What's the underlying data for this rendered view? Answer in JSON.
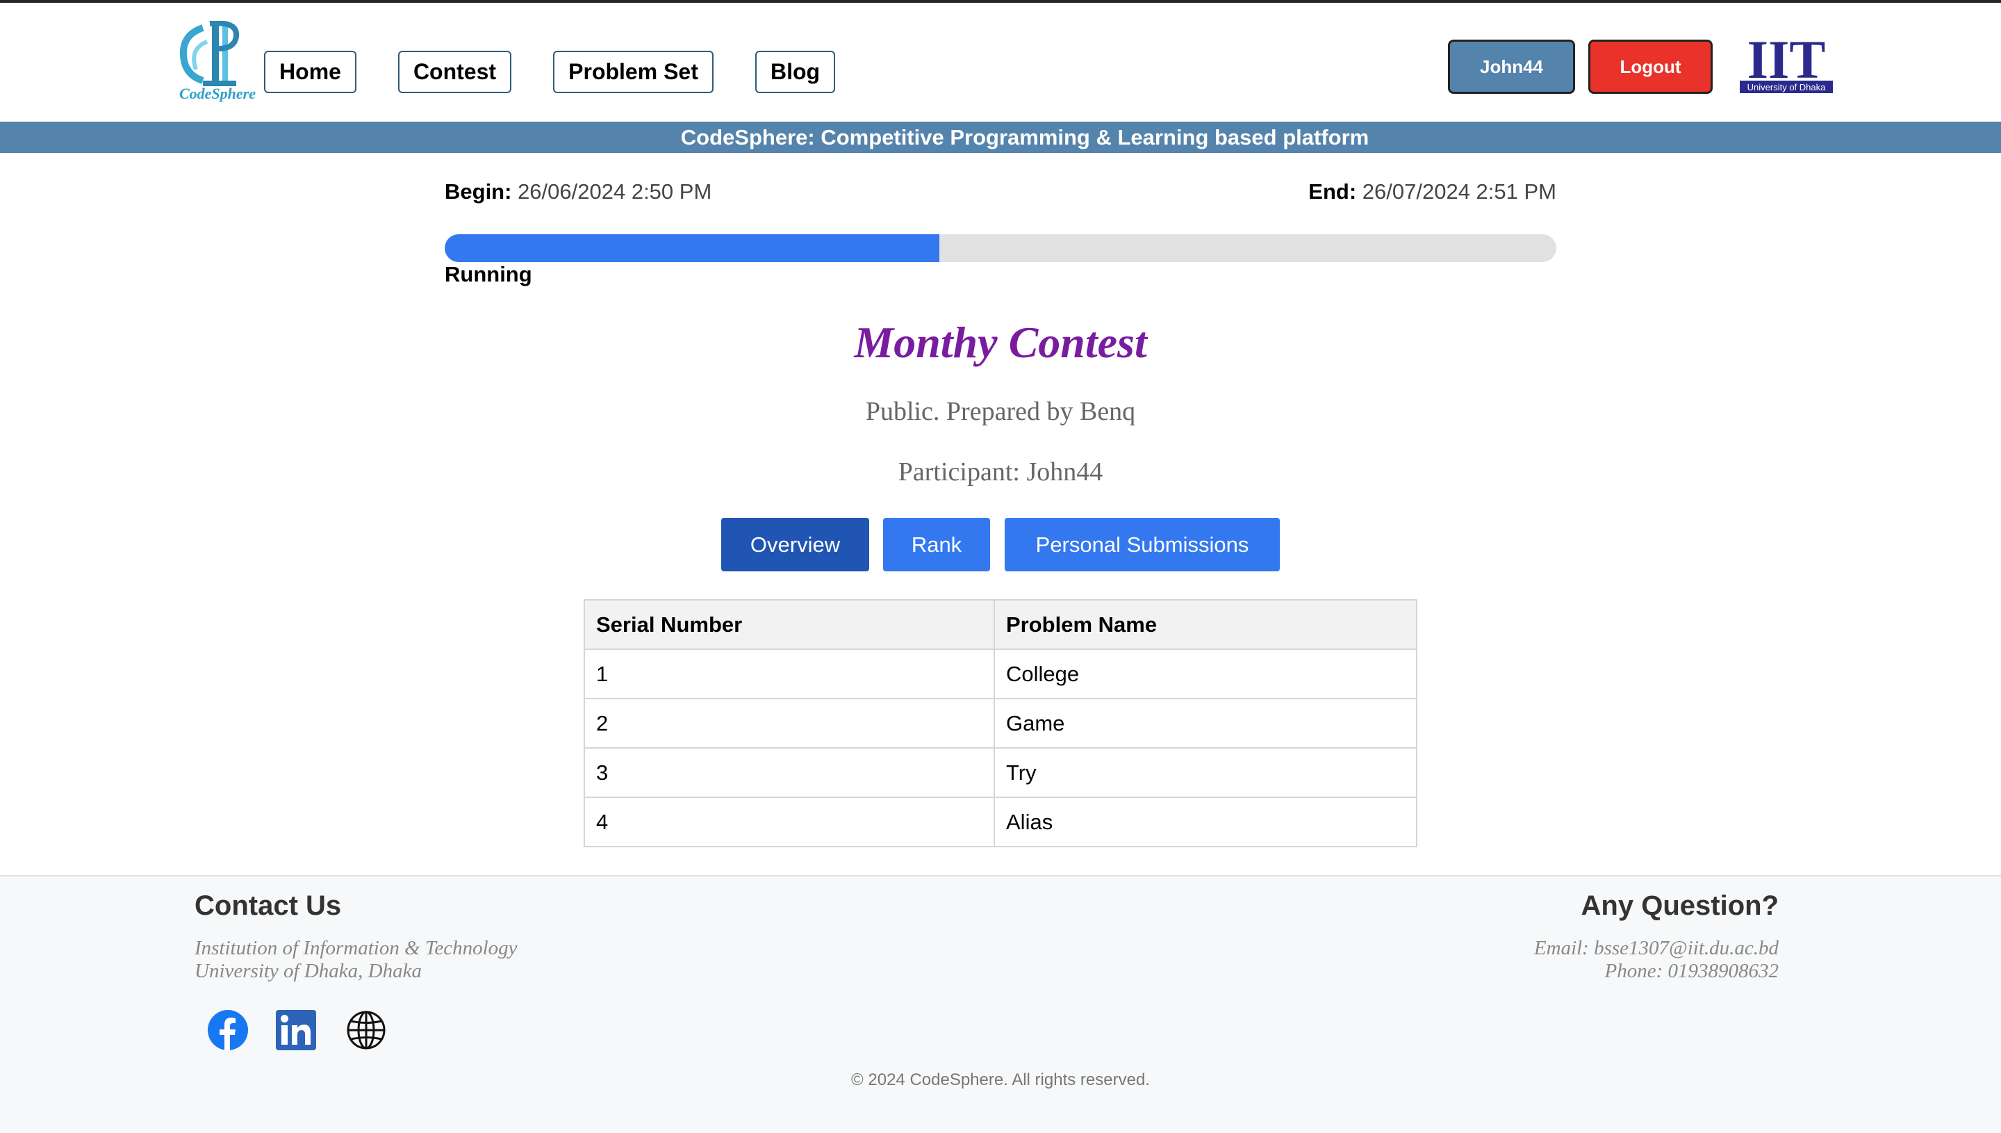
{
  "header": {
    "logo_text": "CodeSphere",
    "nav": [
      "Home",
      "Contest",
      "Problem Set",
      "Blog"
    ],
    "user_button": "John44",
    "logout_button": "Logout",
    "iit_logo_text": "IIT",
    "iit_logo_sub": "University of Dhaka"
  },
  "banner": "CodeSphere: Competitive Programming & Learning based platform",
  "contest": {
    "begin_label": "Begin:",
    "begin_value": "26/06/2024 2:50 PM",
    "end_label": "End:",
    "end_value": "26/07/2024 2:51 PM",
    "progress_fraction": 0.445,
    "status": "Running",
    "title": "Monthy Contest",
    "visibility": "Public. Prepared by Benq",
    "participant": "Participant: John44"
  },
  "tabs": [
    "Overview",
    "Rank",
    "Personal Submissions"
  ],
  "table": {
    "headers": [
      "Serial Number",
      "Problem Name"
    ],
    "rows": [
      [
        "1",
        "College"
      ],
      [
        "2",
        "Game"
      ],
      [
        "3",
        "Try"
      ],
      [
        "4",
        "Alias"
      ]
    ]
  },
  "footer": {
    "contact_title": "Contact Us",
    "contact_line1": "Institution of Information & Technology",
    "contact_line2": "University of Dhaka, Dhaka",
    "question_title": "Any Question?",
    "email": "Email: bsse1307@iit.du.ac.bd",
    "phone": "Phone: 01938908632",
    "social_icons": [
      "facebook-icon",
      "linkedin-icon",
      "globe-icon"
    ],
    "copyright": "© 2024 CodeSphere. All rights reserved."
  },
  "colors": {
    "banner": "#5483ab",
    "progress": "#3478f0",
    "title": "#7a1ca0",
    "tab_active": "#2155b3",
    "tab": "#3478f0",
    "user_button": "#5483ab",
    "logout_button": "#e9332a"
  }
}
